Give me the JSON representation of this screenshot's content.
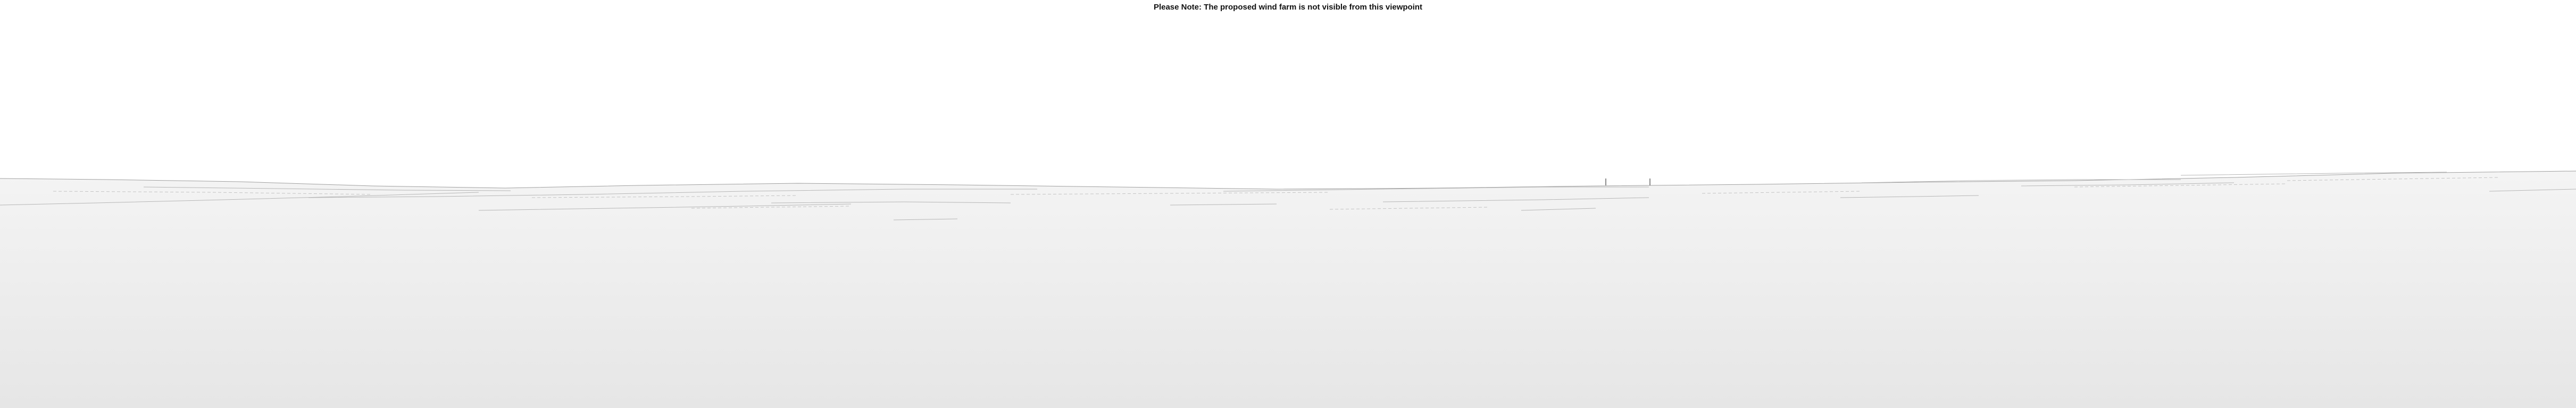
{
  "viewpoint": {
    "note_text": "Please Note: The proposed wind farm is not visible from this viewpoint",
    "colors": {
      "sky": "#ffffff",
      "ground_top": "#f3f3f3",
      "ground_bottom": "#e6e6e6",
      "ridge_line": "#9a9a9a",
      "contour_line": "#b4b4b4",
      "mast": "#666666"
    }
  }
}
